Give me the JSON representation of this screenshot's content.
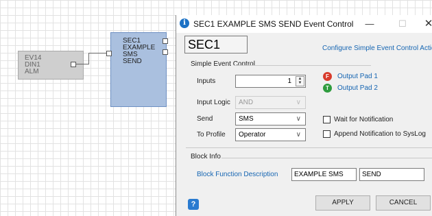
{
  "canvas": {
    "source_block": {
      "lines": [
        "EV14",
        "DIN1",
        "ALM"
      ]
    },
    "sec_block": {
      "lines": [
        "SEC1",
        "EXAMPLE SMS",
        "SEND"
      ]
    }
  },
  "dialog": {
    "title": "SEC1 EXAMPLE SMS SEND Event Control",
    "name": "SEC1",
    "configure_link": "Configure Simple Event Control Actions",
    "simple_event_control": {
      "group_title": "Simple Event Control",
      "inputs_label": "Inputs",
      "inputs_value": "1",
      "input_logic_label": "Input Logic",
      "input_logic_value": "AND",
      "send_label": "Send",
      "send_value": "SMS",
      "to_profile_label": "To Profile",
      "to_profile_value": "Operator"
    },
    "output_pads": [
      {
        "letter": "F",
        "label": "Output Pad 1",
        "color": "#d83b2c"
      },
      {
        "letter": "T",
        "label": "Output Pad 2",
        "color": "#2f9c3e"
      }
    ],
    "checkboxes": [
      {
        "label": "Wait for Notification",
        "checked": false
      },
      {
        "label": "Append Notification to SysLog",
        "checked": false
      }
    ],
    "block_info": {
      "group_title": "Block Info",
      "description_link": "Block Function Description",
      "field1": "EXAMPLE SMS",
      "field2": "SEND"
    },
    "buttons": {
      "apply": "APPLY",
      "cancel": "CANCEL"
    }
  }
}
